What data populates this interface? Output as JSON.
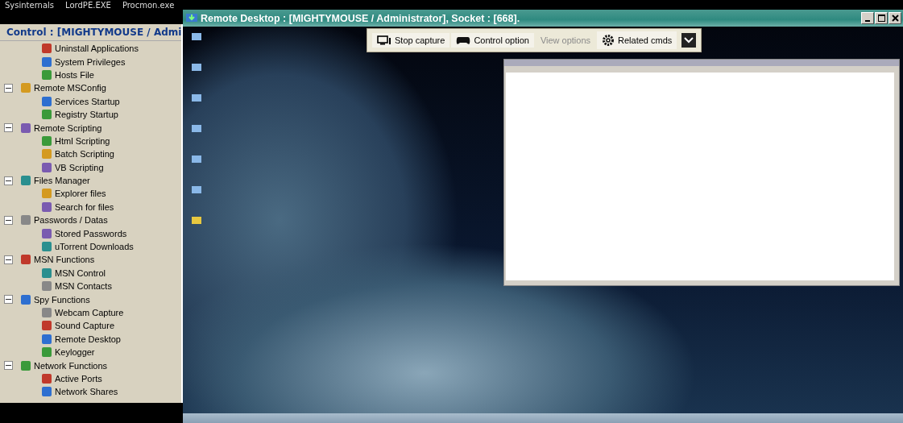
{
  "top_bar": {
    "items": [
      "Sysinternals",
      "LordPE.EXE",
      "Procmon.exe"
    ]
  },
  "control_panel": {
    "title": "Control : [MIGHTYMOUSE / Admi",
    "continued_children": [
      "Uninstall Applications",
      "System Privileges",
      "Hosts File"
    ],
    "groups": [
      {
        "label": "Remote MSConfig",
        "expanded": true,
        "children": [
          "Services Startup",
          "Registry Startup"
        ]
      },
      {
        "label": "Remote Scripting",
        "expanded": true,
        "children": [
          "Html Scripting",
          "Batch Scripting",
          "VB Scripting"
        ]
      },
      {
        "label": "Files Manager",
        "expanded": true,
        "children": [
          "Explorer files",
          "Search for files"
        ]
      },
      {
        "label": "Passwords / Datas",
        "expanded": true,
        "children": [
          "Stored Passwords",
          "uTorrent Downloads"
        ]
      },
      {
        "label": "MSN Functions",
        "expanded": true,
        "children": [
          "MSN Control",
          "MSN Contacts"
        ]
      },
      {
        "label": "Spy Functions",
        "expanded": true,
        "children": [
          "Webcam Capture",
          "Sound Capture",
          "Remote Desktop",
          "Keylogger"
        ]
      },
      {
        "label": "Network Functions",
        "expanded": true,
        "children": [
          "Active Ports",
          "Network Shares"
        ]
      }
    ]
  },
  "remote_window": {
    "title": "Remote Desktop : [MIGHTYMOUSE / Administrator], Socket : [668].",
    "toolbar": [
      {
        "label": "Stop capture",
        "kind": "monitor",
        "disabled": false
      },
      {
        "label": "Control option",
        "kind": "gamepad",
        "disabled": false
      },
      {
        "label": "View options",
        "kind": "text",
        "disabled": true
      },
      {
        "label": "Related cmds",
        "kind": "gear",
        "disabled": false
      }
    ]
  }
}
